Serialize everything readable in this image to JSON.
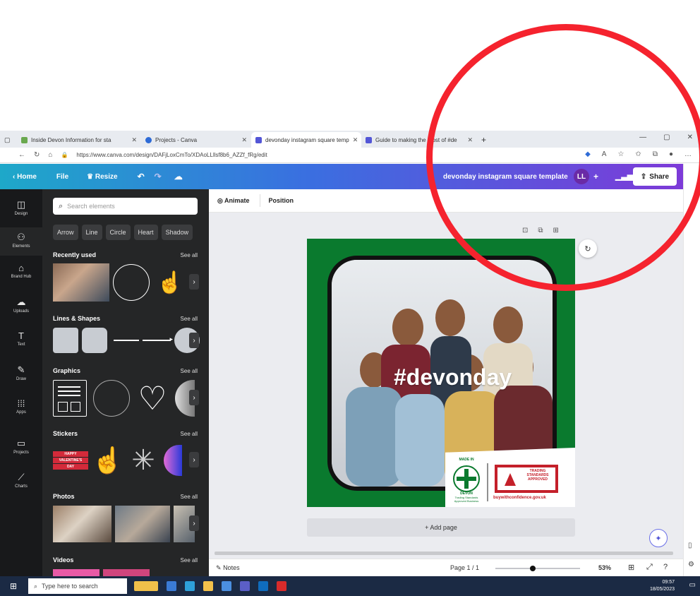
{
  "tabs": [
    {
      "title": "Inside Devon Information for sta",
      "color": "#6aa84f"
    },
    {
      "title": "Projects - Canva",
      "color": "#2e6bd6"
    },
    {
      "title": "devonday instagram square temp",
      "color": "#5356d6"
    },
    {
      "title": "Guide to making the most of #de",
      "color": "#5356d6"
    }
  ],
  "new_tab": "+",
  "browser": {
    "url": "https://www.canva.com/design/DAFjLoxCmTo/XDAoLLllsf8b6_AZZf_fRg/edit"
  },
  "header": {
    "home": "Home",
    "file": "File",
    "resize": "Resize",
    "title": "devonday instagram square template",
    "avatar": "LL",
    "plus": "+",
    "share": "Share"
  },
  "rail": [
    {
      "label": "Design",
      "icon": "design-icon",
      "glyph": "◫"
    },
    {
      "label": "Elements",
      "icon": "elements-icon",
      "glyph": "⚇"
    },
    {
      "label": "Brand Hub",
      "icon": "brand-hub-icon",
      "glyph": "⌂"
    },
    {
      "label": "Uploads",
      "icon": "upload-icon",
      "glyph": "☁"
    },
    {
      "label": "Text",
      "icon": "text-icon",
      "glyph": "T"
    },
    {
      "label": "Draw",
      "icon": "draw-icon",
      "glyph": "✎"
    },
    {
      "label": "Apps",
      "icon": "apps-icon",
      "glyph": "⋮⋮"
    },
    {
      "label": "Projects",
      "icon": "folder-icon",
      "glyph": "▭"
    },
    {
      "label": "Charts",
      "icon": "chart-icon",
      "glyph": "⟋"
    }
  ],
  "panel": {
    "search_placeholder": "Search elements",
    "chips": [
      "Arrow",
      "Line",
      "Circle",
      "Heart",
      "Shadow"
    ],
    "sections": [
      "Recently used",
      "Lines & Shapes",
      "Graphics",
      "Stickers",
      "Photos",
      "Videos"
    ],
    "see_all": "See all",
    "sticker_text": [
      "HAPPY",
      "VALENTINE'S",
      "DAY"
    ]
  },
  "toolbar": {
    "animate": "Animate",
    "position": "Position"
  },
  "canvas": {
    "hashtag": "#devonday",
    "badge_left": [
      "MADE IN",
      "DEVON",
      "Trading Standards",
      "Approved Business"
    ],
    "badge_right": [
      "TRADING",
      "STANDARDS",
      "APPROVED"
    ],
    "badge_url": "buywithconfidence.gov.uk",
    "add_page": "+ Add page"
  },
  "footer": {
    "notes": "Notes",
    "page": "Page 1 / 1",
    "zoom": "53%",
    "zoom_level": 0.53
  },
  "taskbar": {
    "search": "Type here to search",
    "time": "09:57",
    "date": "18/05/2023"
  },
  "colors": {
    "annotation_ring": "#f5232e",
    "design_bg": "#0a7a2e",
    "panel_bg": "#252627"
  }
}
